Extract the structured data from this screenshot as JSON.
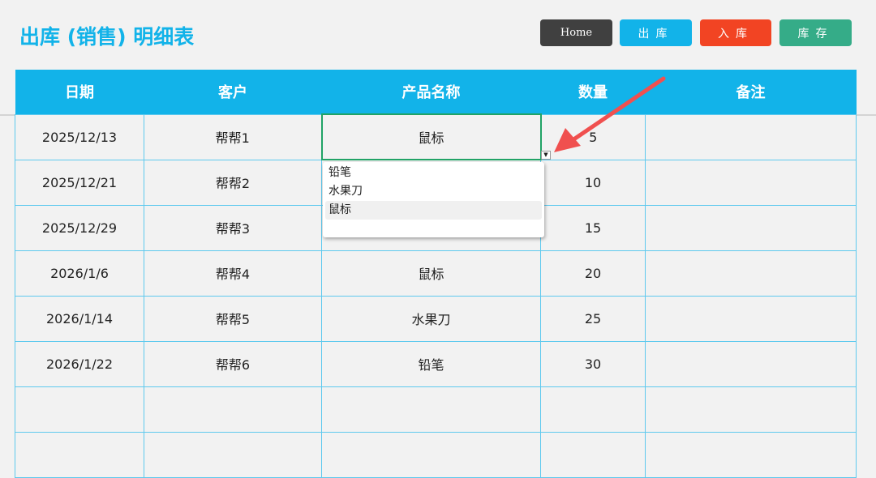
{
  "title": "出库 (销售) 明细表",
  "buttons": {
    "home": "Home",
    "out": "出库",
    "in": "入库",
    "stock": "库存"
  },
  "colors": {
    "accent": "#12b3e9",
    "home": "#404040",
    "in": "#f24423",
    "stock": "#35ac88"
  },
  "table": {
    "headers": [
      "日期",
      "客户",
      "产品名称",
      "数量",
      "备注"
    ],
    "rows": [
      [
        "2025/12/13",
        "帮帮1",
        "鼠标",
        "5",
        ""
      ],
      [
        "2025/12/21",
        "帮帮2",
        "",
        "10",
        ""
      ],
      [
        "2025/12/29",
        "帮帮3",
        "",
        "15",
        ""
      ],
      [
        "2026/1/6",
        "帮帮4",
        "鼠标",
        "20",
        ""
      ],
      [
        "2026/1/14",
        "帮帮5",
        "水果刀",
        "25",
        ""
      ],
      [
        "2026/1/22",
        "帮帮6",
        "铅笔",
        "30",
        ""
      ],
      [
        "",
        "",
        "",
        "",
        ""
      ],
      [
        "",
        "",
        "",
        "",
        ""
      ]
    ]
  },
  "dropdown": {
    "options": [
      "铅笔",
      "水果刀",
      "鼠标"
    ],
    "highlighted": "鼠标"
  }
}
